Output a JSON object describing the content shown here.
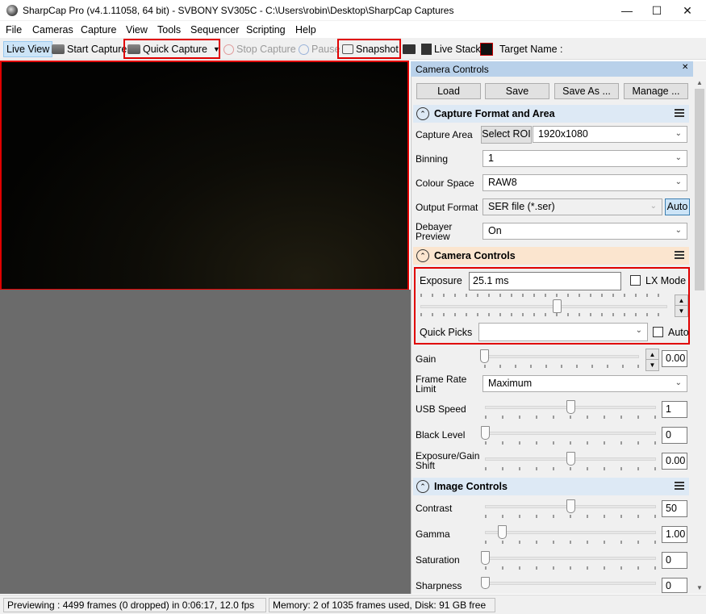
{
  "window": {
    "title": "SharpCap Pro (v4.1.11058, 64 bit) - SVBONY SV305C - C:\\Users\\robin\\Desktop\\SharpCap Captures",
    "minimize_glyph": "—",
    "maximize_glyph": "☐",
    "close_glyph": "✕"
  },
  "menu": [
    "File",
    "Cameras",
    "Capture",
    "View",
    "Tools",
    "Sequencer",
    "Scripting",
    "Help"
  ],
  "toolbar": {
    "live_view": "Live View",
    "start_capture": "Start Capture",
    "quick_capture": "Quick Capture",
    "stop_capture": "Stop Capture",
    "pause": "Pause",
    "snapshot": "Snapshot",
    "live_stack": "Live Stack",
    "target_name_label": "Target Name :",
    "target_name_value": ""
  },
  "panel": {
    "title": "Camera Controls",
    "buttons": {
      "load": "Load",
      "save": "Save",
      "save_as": "Save As ...",
      "manage": "Manage ..."
    }
  },
  "capture_format": {
    "heading": "Capture Format and Area",
    "capture_area_label": "Capture Area",
    "select_roi": "Select ROI",
    "capture_area_value": "1920x1080",
    "binning_label": "Binning",
    "binning_value": "1",
    "colour_space_label": "Colour Space",
    "colour_space_value": "RAW8",
    "output_format_label": "Output Format",
    "output_format_value": "SER file (*.ser)",
    "auto_button": "Auto",
    "debayer_label_1": "Debayer",
    "debayer_label_2": "Preview",
    "debayer_value": "On"
  },
  "camera_controls": {
    "heading": "Camera Controls",
    "exposure_label": "Exposure",
    "exposure_value": "25.1 ms",
    "lx_mode_label": "LX Mode",
    "quick_picks_label": "Quick Picks",
    "quick_picks_value": "",
    "auto_label": "Auto",
    "gain_label": "Gain",
    "gain_value": "0.00",
    "frame_rate_label_1": "Frame Rate",
    "frame_rate_label_2": "Limit",
    "frame_rate_value": "Maximum",
    "usb_speed_label": "USB Speed",
    "usb_speed_value": "1",
    "black_level_label": "Black Level",
    "black_level_value": "0",
    "exp_gain_shift_label_1": "Exposure/Gain",
    "exp_gain_shift_label_2": "Shift",
    "exp_gain_shift_value": "0.00"
  },
  "image_controls": {
    "heading": "Image Controls",
    "contrast_label": "Contrast",
    "contrast_value": "50",
    "gamma_label": "Gamma",
    "gamma_value": "1.00",
    "saturation_label": "Saturation",
    "saturation_value": "0",
    "sharpness_label": "Sharpness",
    "sharpness_value": "0"
  },
  "status": {
    "previewing": "Previewing : 4499 frames (0 dropped) in 0:06:17, 12.0 fps",
    "memory": "Memory: 2 of 1035 frames used, Disk: 91 GB free"
  },
  "colors": {
    "highlight_red": "#e00000",
    "panel_header_blue": "#b9d1ea",
    "section_bg": "#dde9f5",
    "camera_controls_bg": "#fbe5cf",
    "live_view_bg": "#cce4f7"
  }
}
